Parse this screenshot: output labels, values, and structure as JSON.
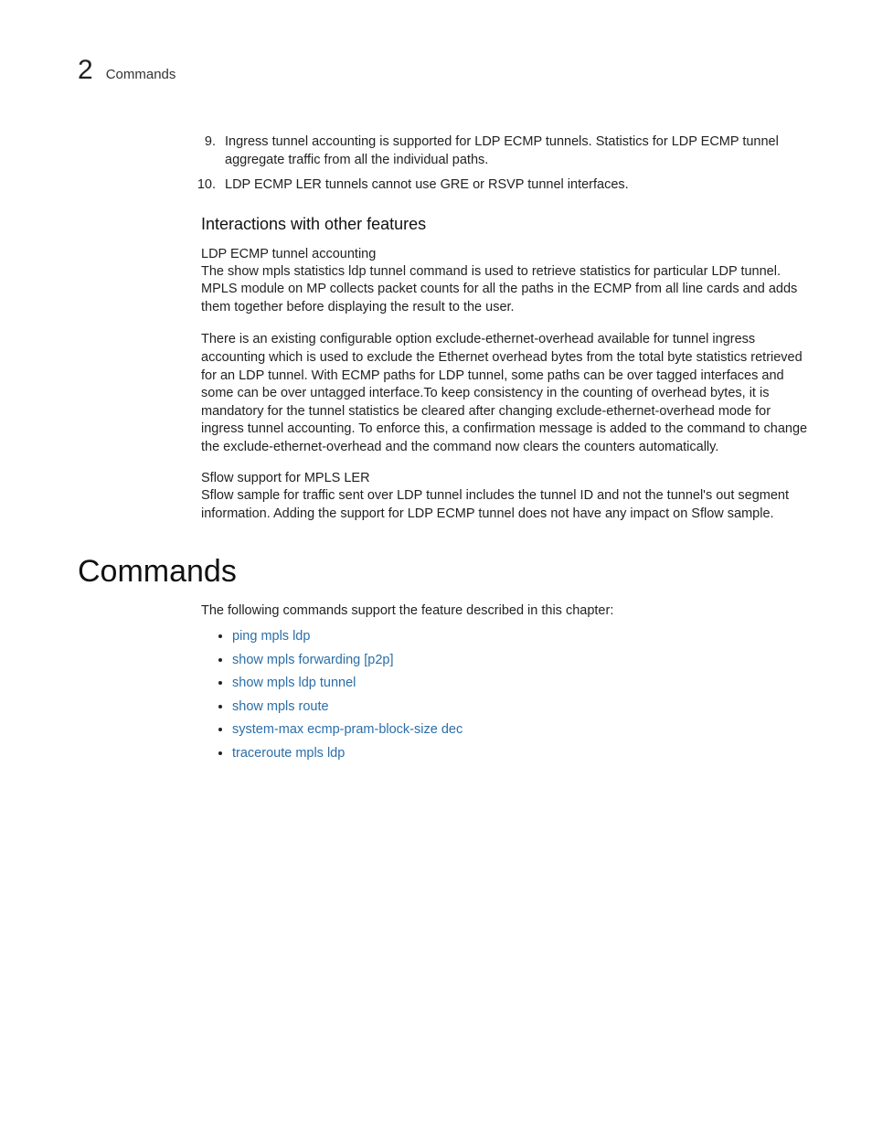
{
  "header": {
    "chapter_number": "2",
    "chapter_title": "Commands"
  },
  "numbered_start": 9,
  "numbered": [
    "Ingress tunnel accounting is supported for LDP ECMP tunnels. Statistics for LDP ECMP tunnel aggregate traffic from all the individual paths.",
    "LDP ECMP LER tunnels cannot use GRE or RSVP tunnel interfaces."
  ],
  "interactions": {
    "heading": "Interactions with other features",
    "sections": [
      {
        "title": "LDP ECMP tunnel accounting",
        "paras": [
          "The show mpls statistics ldp tunnel command is used to retrieve statistics for particular LDP tunnel. MPLS module on MP collects packet counts for all the paths in the ECMP from all line cards and adds them together before displaying the result to the user.",
          "There is an existing configurable option exclude-ethernet-overhead available for tunnel ingress accounting which is used to exclude the Ethernet overhead bytes from the total byte statistics retrieved for an LDP tunnel. With ECMP paths for LDP tunnel, some paths can be over tagged interfaces and some can be over untagged interface.To keep consistency in the counting of overhead bytes, it is mandatory for the tunnel statistics be cleared after changing exclude-ethernet-overhead mode for ingress tunnel accounting. To enforce this, a confirmation message is added to the command to change the exclude-ethernet-overhead and the command now clears the counters automatically."
        ]
      },
      {
        "title": "Sflow support for MPLS LER",
        "paras": [
          "Sflow sample for traffic sent over LDP tunnel includes the tunnel ID and not the tunnel's out segment information. Adding the support for LDP ECMP tunnel does not have any impact on Sflow sample."
        ]
      }
    ]
  },
  "commands": {
    "heading": "Commands",
    "intro": "The following commands support the feature described in this chapter:",
    "items": [
      "ping mpls ldp",
      "show mpls forwarding [p2p]",
      "show mpls ldp tunnel",
      "show mpls route",
      "system-max ecmp-pram-block-size dec",
      "traceroute mpls ldp"
    ]
  }
}
